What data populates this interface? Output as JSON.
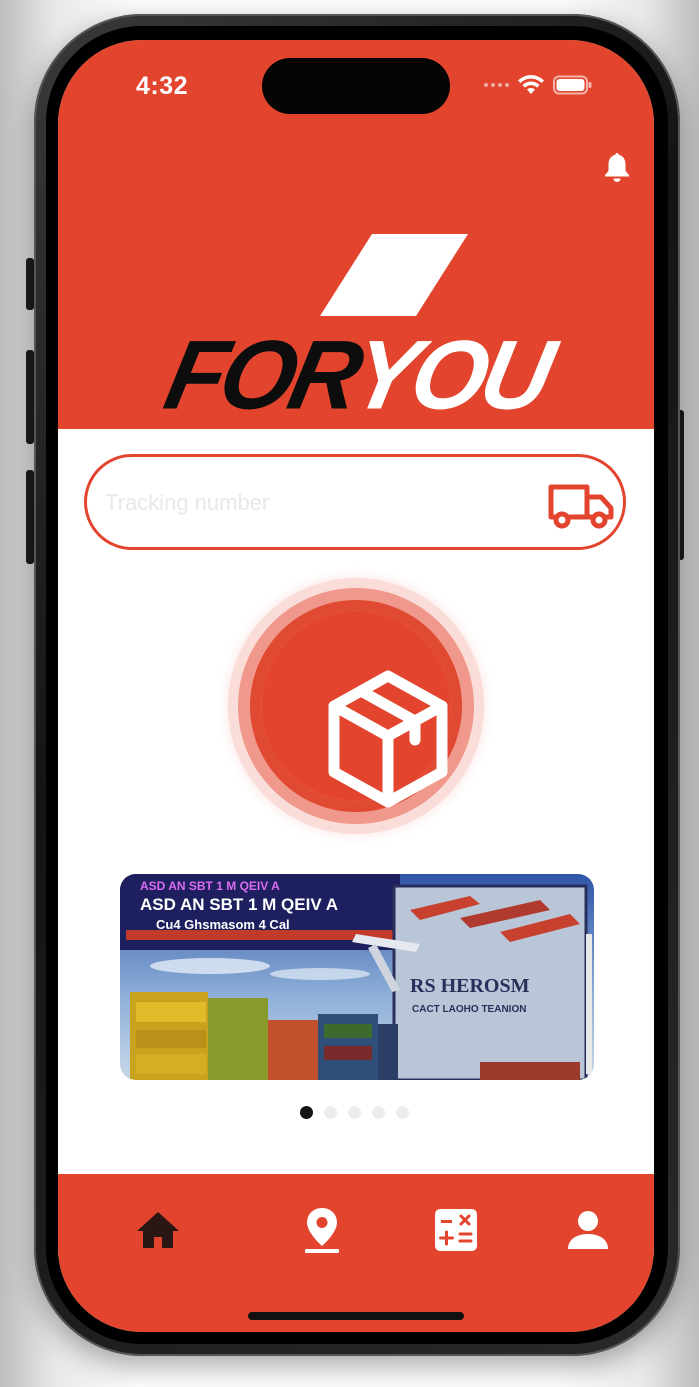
{
  "status_bar": {
    "time": "4:32"
  },
  "logo": {
    "part1": "FOR",
    "part2": "YOU"
  },
  "search": {
    "placeholder": "Tracking number",
    "value": ""
  },
  "banner": {
    "text_lines": [
      "ASD AN SBT 1 M QEIV A",
      "Cu4 Ghsmasom 4 Cal",
      "RS HEROSM",
      "CACT LAOHO TEANION"
    ]
  },
  "carousel": {
    "page_count": 5,
    "active_index": 0
  },
  "nav": {
    "items": [
      "home-icon",
      "location-pin-icon",
      "calculator-icon",
      "profile-icon"
    ]
  },
  "colors": {
    "brand": "#e2442d",
    "dark": "#0d0d0d",
    "white": "#ffffff"
  }
}
